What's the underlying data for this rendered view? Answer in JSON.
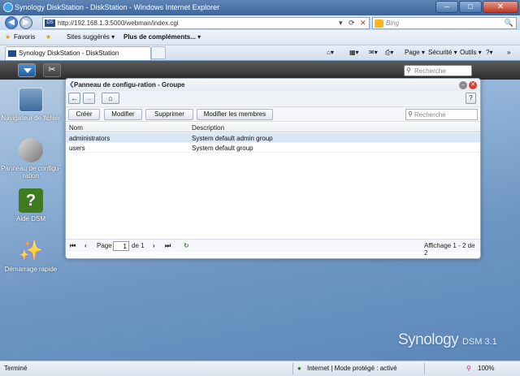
{
  "browser": {
    "title": "Synology DiskStation - DiskStation - Windows Internet Explorer",
    "address": "http://192.168.1.3:5000/webman/index.cgi",
    "search_placeholder": "Bing",
    "favorites_label": "Favoris",
    "fav_items": [
      "Sites suggérés ▾",
      "Plus de compléments... ▾"
    ],
    "tab_label": "Synology DiskStation - DiskStation",
    "commands": [
      "Page ▾",
      "Sécurité ▾",
      "Outils ▾"
    ],
    "status_left": "Terminé",
    "status_zone": "Internet | Mode protégé : activé",
    "zoom": "100%"
  },
  "dsm": {
    "search_placeholder": "Recherche",
    "desktop_icons": [
      {
        "label": "Navigateur de fichier",
        "icon": "file-browser-icon"
      },
      {
        "label": "Panneau de configu-ration",
        "icon": "control-panel-icon"
      },
      {
        "label": "Aide DSM",
        "icon": "help-icon"
      },
      {
        "label": "Démarrage rapide",
        "icon": "quick-start-icon"
      }
    ],
    "logo_main": "Synology",
    "logo_sub": "DSM 3.1"
  },
  "window": {
    "title": "Panneau de configu-ration - Groupe",
    "toolbar": {
      "create": "Créer",
      "modify": "Modifier",
      "delete": "Supprimer",
      "members": "Modifier les membres",
      "search_placeholder": "Recherche"
    },
    "columns": [
      "Nom",
      "Description"
    ],
    "rows": [
      {
        "name": "administrators",
        "description": "System default admin group"
      },
      {
        "name": "users",
        "description": "System default group"
      }
    ],
    "pager": {
      "page_label": "Page",
      "page": "1",
      "of_label": "de 1",
      "display": "Affichage 1 - 2 de 2"
    }
  }
}
